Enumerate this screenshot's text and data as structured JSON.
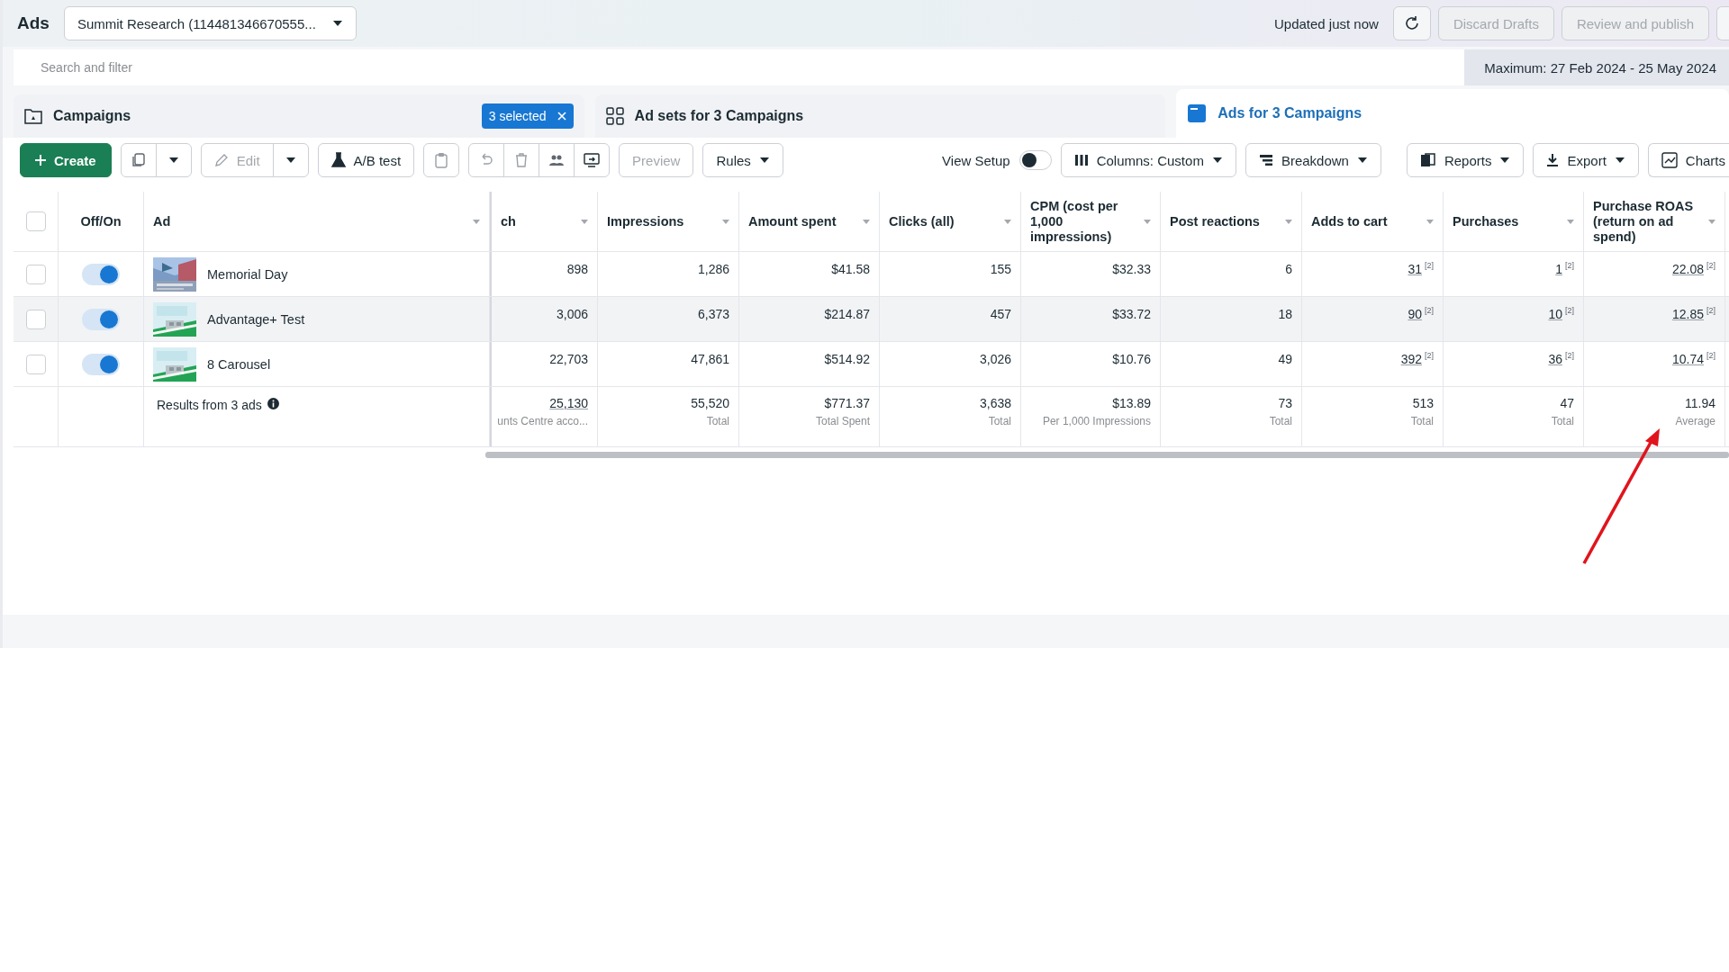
{
  "header": {
    "title": "Ads",
    "account": "Summit Research (114481346670555...",
    "status": "Updated just now",
    "discard": {
      "label": "Discard Drafts",
      "disabled": true
    },
    "publish": {
      "label": "Review and publish",
      "disabled": true
    }
  },
  "search": {
    "placeholder": "Search and filter"
  },
  "date_range": "Maximum: 27 Feb 2024 - 25 May 2024",
  "tabs": [
    {
      "label": "Campaigns",
      "selected": false,
      "badge": "3 selected"
    },
    {
      "label": "Ad sets for 3 Campaigns",
      "selected": false
    },
    {
      "label": "Ads for 3 Campaigns",
      "selected": true
    }
  ],
  "toolbar": {
    "create": "Create",
    "edit": {
      "label": "Edit",
      "disabled": true
    },
    "ab_test": "A/B test",
    "preview": {
      "label": "Preview",
      "disabled": true
    },
    "rules": "Rules",
    "view_setup": {
      "label": "View Setup",
      "on": false
    },
    "columns": "Columns: Custom",
    "breakdown": "Breakdown",
    "reports": "Reports",
    "export": "Export",
    "charts": "Charts"
  },
  "table": {
    "select_all": {
      "checked": false
    },
    "fixed_columns": [
      "Off/On",
      "Ad"
    ],
    "columns": [
      "ch",
      "Impressions",
      "Amount spent",
      "Clicks (all)",
      "CPM (cost per 1,000 impressions)",
      "Post reactions",
      "Adds to cart",
      "Purchases",
      "Purchase ROAS (return on ad spend)"
    ],
    "rows": [
      {
        "checked": false,
        "on": true,
        "hovered": false,
        "ad": "Memorial Day",
        "cells": [
          {
            "value": "898"
          },
          {
            "value": "1,286"
          },
          {
            "value": "$41.58"
          },
          {
            "value": "155"
          },
          {
            "value": "$32.33"
          },
          {
            "value": "6"
          },
          {
            "value": "31",
            "note": "[2]"
          },
          {
            "value": "1",
            "note": "[2]"
          },
          {
            "value": "22.08",
            "note": "[2]"
          }
        ]
      },
      {
        "checked": false,
        "on": true,
        "hovered": true,
        "ad": "Advantage+ Test",
        "cells": [
          {
            "value": "3,006"
          },
          {
            "value": "6,373"
          },
          {
            "value": "$214.87"
          },
          {
            "value": "457"
          },
          {
            "value": "$33.72"
          },
          {
            "value": "18"
          },
          {
            "value": "90",
            "note": "[2]"
          },
          {
            "value": "10",
            "note": "[2]"
          },
          {
            "value": "12.85",
            "note": "[2]"
          }
        ]
      },
      {
        "checked": false,
        "on": true,
        "hovered": false,
        "ad": "8 Carousel",
        "cells": [
          {
            "value": "22,703"
          },
          {
            "value": "47,861"
          },
          {
            "value": "$514.92"
          },
          {
            "value": "3,026"
          },
          {
            "value": "$10.76"
          },
          {
            "value": "49"
          },
          {
            "value": "392",
            "note": "[2]"
          },
          {
            "value": "36",
            "note": "[2]"
          },
          {
            "value": "10.74",
            "note": "[2]"
          }
        ]
      }
    ],
    "totals": {
      "label": "Results from 3 ads",
      "cells": [
        {
          "value": "25,130",
          "sub": "unts Centre acco...",
          "linked": true
        },
        {
          "value": "55,520",
          "sub": "Total",
          "linked": false
        },
        {
          "value": "$771.37",
          "sub": "Total Spent",
          "linked": false
        },
        {
          "value": "3,638",
          "sub": "Total",
          "linked": false
        },
        {
          "value": "$13.89",
          "sub": "Per 1,000 Impressions",
          "linked": false
        },
        {
          "value": "73",
          "sub": "Total",
          "linked": false
        },
        {
          "value": "513",
          "sub": "Total",
          "linked": false
        },
        {
          "value": "47",
          "sub": "Total",
          "linked": false
        },
        {
          "value": "11.94",
          "sub": "Average",
          "linked": false
        }
      ]
    }
  }
}
